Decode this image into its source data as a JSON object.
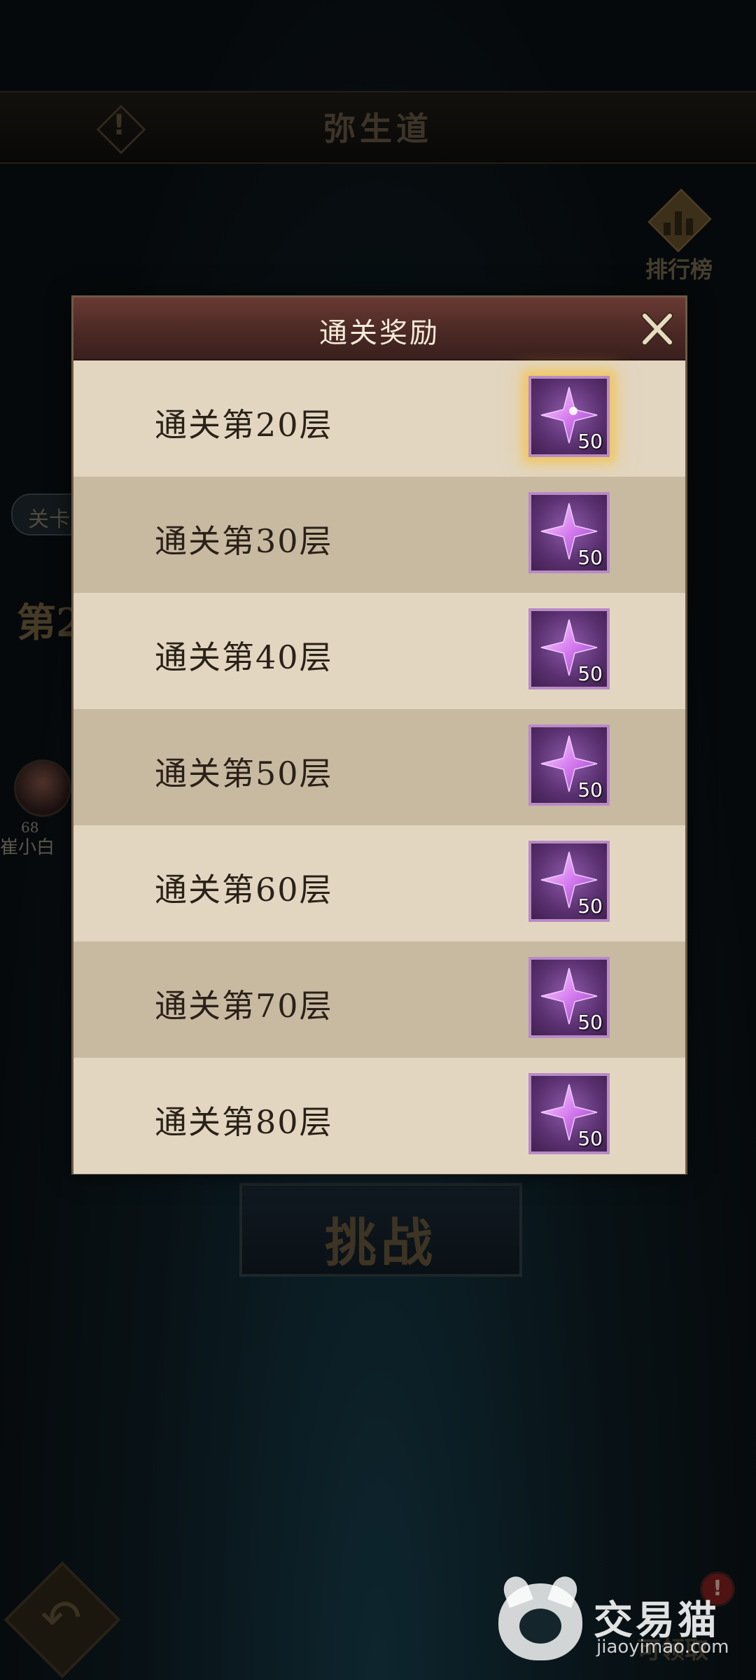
{
  "background": {
    "title": "弥生道",
    "rank_label": "排行榜",
    "side_tab_label": "关卡",
    "side_floor_label": "第2",
    "hero_level": "68",
    "hero_name": "崔小白",
    "challenge_label": "挑战",
    "claim_label": "可领取",
    "claim_badge": "!"
  },
  "watermark": {
    "text": "交易猫",
    "url": "jiaoyimao.com"
  },
  "dialog": {
    "title": "通关奖励",
    "rows": [
      {
        "label": "通关第20层",
        "reward_icon": "purple-star-crystal-icon",
        "count": "50",
        "highlighted": true
      },
      {
        "label": "通关第30层",
        "reward_icon": "purple-star-crystal-icon",
        "count": "50",
        "highlighted": false
      },
      {
        "label": "通关第40层",
        "reward_icon": "purple-star-crystal-icon",
        "count": "50",
        "highlighted": false
      },
      {
        "label": "通关第50层",
        "reward_icon": "purple-star-crystal-icon",
        "count": "50",
        "highlighted": false
      },
      {
        "label": "通关第60层",
        "reward_icon": "purple-star-crystal-icon",
        "count": "50",
        "highlighted": false
      },
      {
        "label": "通关第70层",
        "reward_icon": "purple-star-crystal-icon",
        "count": "50",
        "highlighted": false
      },
      {
        "label": "通关第80层",
        "reward_icon": "purple-star-crystal-icon",
        "count": "50",
        "highlighted": false
      }
    ]
  },
  "colors": {
    "header": "#4b2925",
    "row_light": "#e2d6c1",
    "row_dark": "#c8b9a1",
    "item_border": "#b98ac6",
    "highlight_glow": "#f0c760"
  }
}
